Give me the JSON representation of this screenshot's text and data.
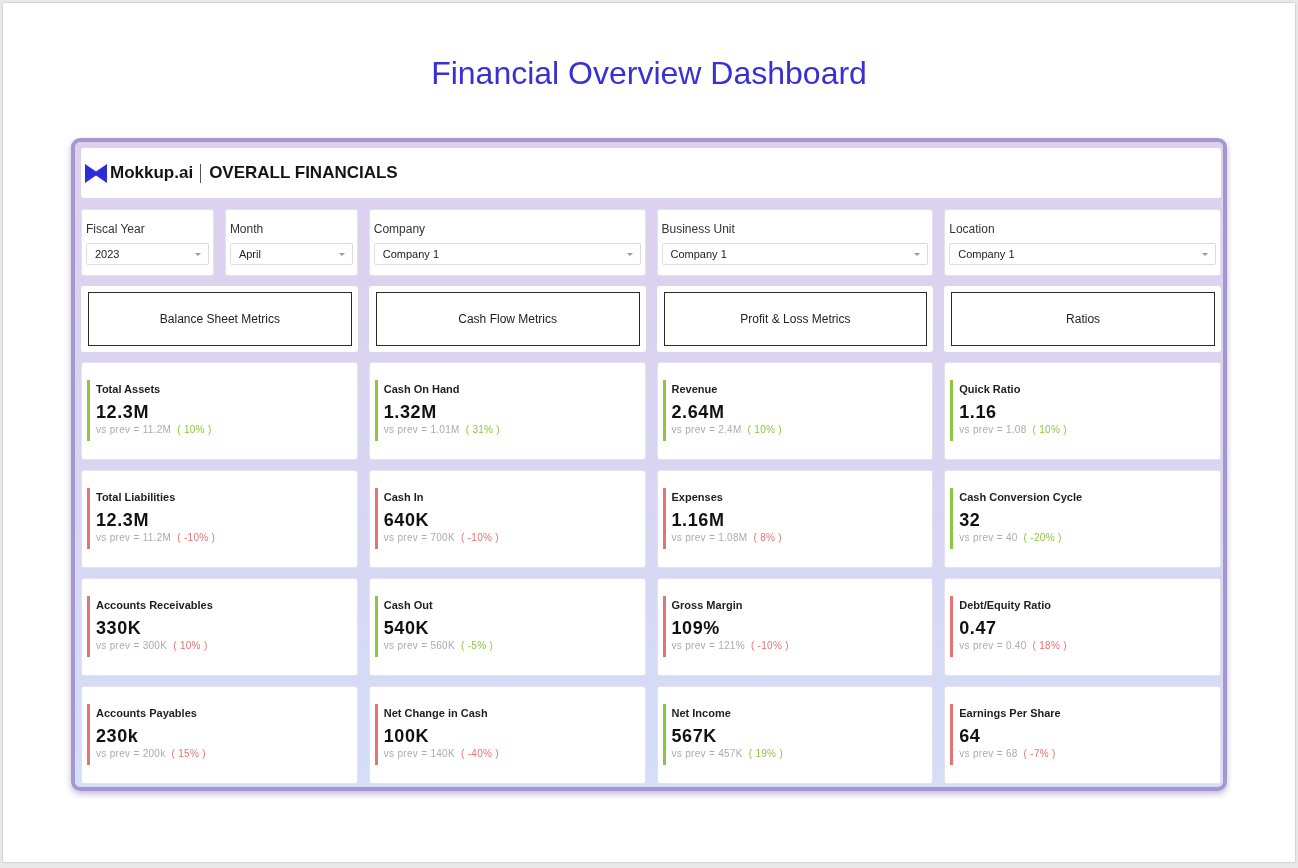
{
  "page_title": "Financial Overview Dashboard",
  "header": {
    "brand": "Mokkup.ai",
    "title": "OVERALL FINANCIALS"
  },
  "filters": [
    {
      "label": "Fiscal Year",
      "value": "2023"
    },
    {
      "label": "Month",
      "value": "April"
    },
    {
      "label": "Company",
      "value": "Company 1"
    },
    {
      "label": "Business Unit",
      "value": "Company 1"
    },
    {
      "label": "Location",
      "value": "Company 1"
    }
  ],
  "sections": [
    {
      "label": "Balance Sheet Metrics",
      "metrics": [
        {
          "label": "Total Assets",
          "value": "12.3M",
          "comparison": "vs prev = 11.2M",
          "change": "( 10% )",
          "color": "#8cc63f"
        },
        {
          "label": "Total Liabilities",
          "value": "12.3M",
          "comparison": "vs prev = 11.2M",
          "change": "( -10% )",
          "color": "#e57373"
        },
        {
          "label": "Accounts Receivables",
          "value": "330K",
          "comparison": "vs prev = 300K",
          "change": "( 10% )",
          "color": "#e57373"
        },
        {
          "label": "Accounts Payables",
          "value": "230k",
          "comparison": "vs prev = 200k",
          "change": "( 15% )",
          "color": "#e57373"
        }
      ]
    },
    {
      "label": "Cash Flow Metrics",
      "metrics": [
        {
          "label": "Cash On Hand",
          "value": "1.32M",
          "comparison": "vs prev = 1.01M",
          "change": "( 31% )",
          "color": "#8cc63f"
        },
        {
          "label": "Cash In",
          "value": "640K",
          "comparison": "vs prev = 700K",
          "change": "( -10% )",
          "color": "#e57373"
        },
        {
          "label": "Cash Out",
          "value": "540K",
          "comparison": "vs prev = 560K",
          "change": "( -5% )",
          "color": "#8cc63f"
        },
        {
          "label": "Net Change in Cash",
          "value": "100K",
          "comparison": "vs prev = 140K",
          "change": "( -40% )",
          "color": "#e57373"
        }
      ]
    },
    {
      "label": "Profit & Loss Metrics",
      "metrics": [
        {
          "label": "Revenue",
          "value": "2.64M",
          "comparison": "vs prev = 2.4M",
          "change": "( 10% )",
          "color": "#8cc63f"
        },
        {
          "label": "Expenses",
          "value": "1.16M",
          "comparison": "vs prev = 1.08M",
          "change": "( 8% )",
          "color": "#e57373"
        },
        {
          "label": "Gross Margin",
          "value": "109%",
          "comparison": "vs prev = 121%",
          "change": "( -10% )",
          "color": "#e57373"
        },
        {
          "label": "Net Income",
          "value": "567K",
          "comparison": "vs prev = 457K",
          "change": "( 19% )",
          "color": "#8cc63f"
        }
      ]
    },
    {
      "label": "Ratios",
      "metrics": [
        {
          "label": "Quick Ratio",
          "value": "1.16",
          "comparison": "vs prev = 1.08",
          "change": "( 10% )",
          "color": "#8cc63f"
        },
        {
          "label": "Cash Conversion Cycle",
          "value": "32",
          "comparison": "vs prev = 40",
          "change": "( -20% )",
          "color": "#8cc63f"
        },
        {
          "label": "Debt/Equity Ratio",
          "value": "0.47",
          "comparison": "vs prev = 0.40",
          "change": "( 18% )",
          "color": "#e57373"
        },
        {
          "label": "Earnings Per Share",
          "value": "64",
          "comparison": "vs prev = 68",
          "change": "( -7% )",
          "color": "#e57373"
        }
      ]
    }
  ]
}
